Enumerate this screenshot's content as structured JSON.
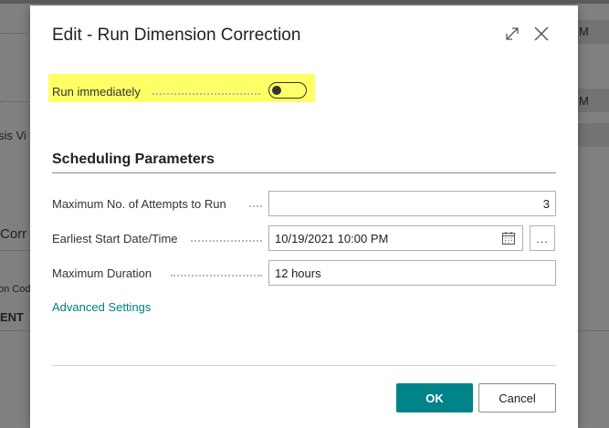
{
  "background": {
    "frag_analysis": "sis Vi",
    "frag_corr": "Corr",
    "frag_code": "on Cod",
    "frag_ent": "ENT",
    "frag_m1": "M",
    "frag_m2": "M"
  },
  "dialog": {
    "title": "Edit - Run Dimension Correction",
    "expand_icon": "expand-icon",
    "close_icon": "close-icon"
  },
  "run_immediately": {
    "label": "Run immediately",
    "value": false,
    "highlight_color": "#ffff66"
  },
  "scheduling": {
    "heading": "Scheduling Parameters",
    "max_attempts_label": "Maximum No. of Attempts to Run",
    "max_attempts_value": "3",
    "earliest_start_label": "Earliest Start Date/Time",
    "earliest_start_value": "10/19/2021 10:00 PM",
    "calendar_icon": "calendar-icon",
    "more_label": "...",
    "max_duration_label": "Maximum Duration",
    "max_duration_value": "12 hours"
  },
  "advanced_link": "Advanced Settings",
  "buttons": {
    "ok": "OK",
    "cancel": "Cancel"
  },
  "colors": {
    "accent": "#008489",
    "link": "#008080"
  }
}
